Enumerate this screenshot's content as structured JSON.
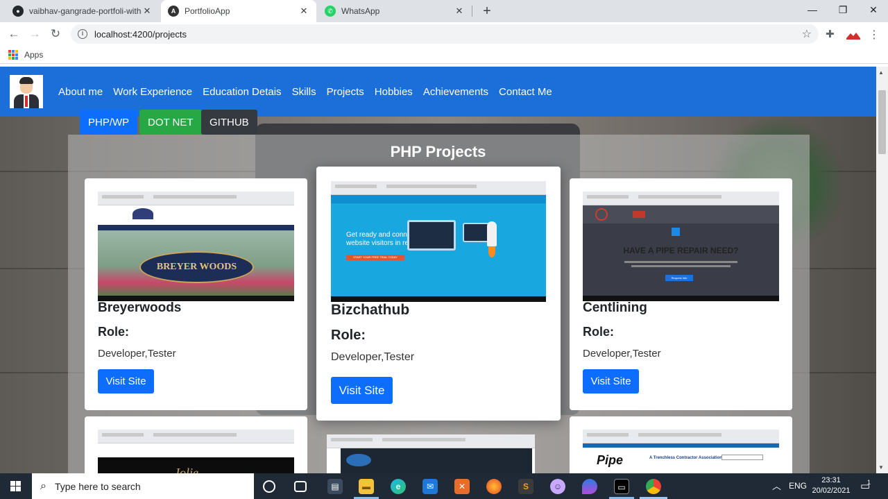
{
  "browser": {
    "tabs": [
      {
        "title": "vaibhav-gangrade-portfoli-with-",
        "icon": "github-icon"
      },
      {
        "title": "PortfolioApp",
        "icon": "angular-icon"
      },
      {
        "title": "WhatsApp",
        "icon": "whatsapp-icon"
      }
    ],
    "close_glyph": "✕",
    "new_tab_glyph": "+",
    "url": "localhost:4200/projects",
    "bookmarks_label": "Apps"
  },
  "app": {
    "nav": [
      "About me",
      "Work Experience",
      "Education Detais",
      "Skills",
      "Projects",
      "Hobbies",
      "Achievements",
      "Contact Me"
    ],
    "tabs": [
      {
        "label": "PHP/WP",
        "color": "#0d6efd"
      },
      {
        "label": "DOT NET",
        "color": "#28a745"
      },
      {
        "label": "GITHUB",
        "color": "#343a40"
      }
    ],
    "section_title": "PHP Projects",
    "role_label": "Role:",
    "visit_label": "Visit Site",
    "projects": [
      {
        "name": "Breyerwoods",
        "role": "Developer,Tester",
        "shot_text": "BREYER WOODS"
      },
      {
        "name": "Bizchathub",
        "role": "Developer,Tester",
        "shot_text": "Get ready and connect to your website visitors in real time",
        "cta": "START YOUR FREE TRIAL TODAY"
      },
      {
        "name": "Centlining",
        "role": "Developer,Tester",
        "shot_text": "HAVE A PIPE REPAIR NEED?",
        "cta": "Request Info"
      }
    ],
    "partial_projects": [
      {
        "shot_text": "Jolie"
      },
      {
        "shot_text": ""
      },
      {
        "shot_text": "Pipe",
        "subtitle": "A Trenchless Contractor Association"
      }
    ]
  },
  "taskbar": {
    "search_placeholder": "Type here to search",
    "language": "ENG",
    "time": "23:31",
    "date": "20/02/2021",
    "notification_count": "1"
  },
  "colors": {
    "nav_blue": "#1c6fd8",
    "button_blue": "#0d6efd",
    "green": "#28a745",
    "dark": "#343a40"
  }
}
